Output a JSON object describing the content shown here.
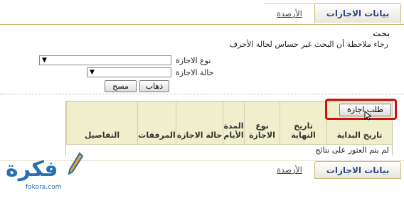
{
  "tabs": {
    "active": "بيانات الاجازات",
    "inactive": "الأرصدة"
  },
  "search": {
    "title": "بحث",
    "note": "رجاء ملاحظة أن البحث غير حساس لحالة الأحرف",
    "leave_type_label": "نوع الاجازة",
    "leave_type_value": "▼",
    "leave_status_label": "حالة الاجازة",
    "leave_status_value": "▼",
    "go_button": "ذهاب",
    "clear_button": "مسح"
  },
  "request_button": "طلب اجازة",
  "table": {
    "columns": [
      "تاريخ البداية",
      "تاريخ النهاية",
      "نوع الاجازة",
      "المدة الأيام",
      "حالة الاجازة",
      "المرفقات",
      "التفاصيل"
    ],
    "empty_message": "لم يتم العثور على نتائج"
  },
  "bottom_tabs": {
    "active": "بيانات الاجازات",
    "inactive": "الأرصدة"
  },
  "watermark": {
    "text": "فكرة",
    "sub": "fokora.com",
    "color": "#2a6fb0"
  },
  "colors": {
    "highlight": "#cc1111",
    "header_bg": "#efefcc",
    "tab_text": "#2b4a86"
  }
}
